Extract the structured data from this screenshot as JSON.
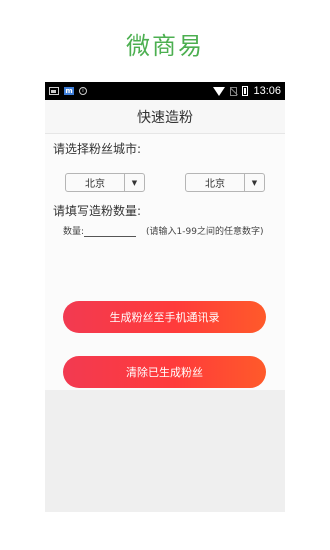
{
  "promo": {
    "title": "微商易"
  },
  "status_bar": {
    "icons_left": [
      "gallery-icon",
      "app-notification-icon",
      "info-icon"
    ],
    "icons_right": [
      "wifi-icon",
      "no-sim-icon",
      "battery-icon"
    ],
    "time": "13:06"
  },
  "header": {
    "title": "快速造粉"
  },
  "city_section": {
    "label": "请选择粉丝城市:",
    "select_left": {
      "value": "北京",
      "arrow": "▼"
    },
    "select_right": {
      "value": "北京",
      "arrow": "▼"
    }
  },
  "quantity_section": {
    "label": "请填写造粉数量:",
    "field_label": "数量:",
    "field_value": "",
    "hint": "(请输入1-99之间的任意数字)"
  },
  "buttons": {
    "generate": "生成粉丝至手机通讯录",
    "clear": "清除已生成粉丝"
  },
  "colors": {
    "promo_green": "#4caf50",
    "button_gradient_start": "#f23a51",
    "button_gradient_end": "#ff5a2a"
  }
}
